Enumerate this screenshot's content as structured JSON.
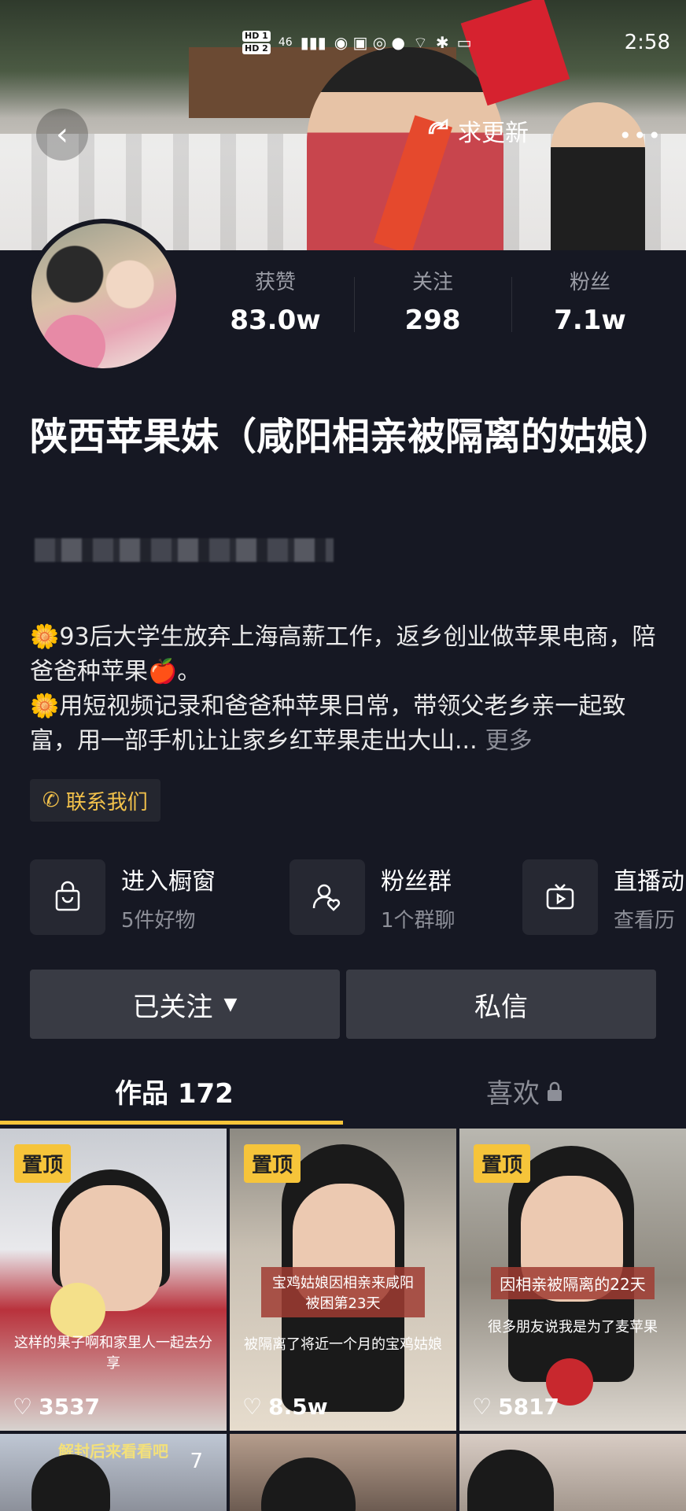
{
  "status_bar": {
    "hd1": "HD 1",
    "hd2": "HD 2",
    "network": "46",
    "time": "2:58"
  },
  "header": {
    "back_icon": "chevron-left-icon",
    "update_label": "求更新",
    "more_icon": "more-dots-icon"
  },
  "profile": {
    "stats": [
      {
        "label": "获赞",
        "value": "83.0w"
      },
      {
        "label": "关注",
        "value": "298"
      },
      {
        "label": "粉丝",
        "value": "7.1w"
      }
    ],
    "name": "陕西苹果妹（咸阳相亲被隔离的姑娘）",
    "bio_line1": "🌼93后大学生放弃上海高薪工作，返乡创业做苹果电商，陪爸爸种苹果🍎。",
    "bio_line2": "🌼用短视频记录和爸爸种苹果日常，带领父老乡亲一起致富，用一部手机让让家乡红苹果走出大山...",
    "bio_more": "更多",
    "contact_label": "联系我们"
  },
  "features": [
    {
      "title": "进入橱窗",
      "sub": "5件好物",
      "icon": "shopping-bag-icon"
    },
    {
      "title": "粉丝群",
      "sub": "1个群聊",
      "icon": "fan-group-icon"
    },
    {
      "title": "直播动",
      "sub": "查看历",
      "icon": "live-tv-icon"
    }
  ],
  "actions": {
    "follow_label": "已关注",
    "message_label": "私信"
  },
  "tabs": {
    "works": "作品 172",
    "likes": "喜欢"
  },
  "videos": [
    {
      "pin": "置顶",
      "likes": "3537",
      "caption": "这样的果子啊和家里人一起去分享"
    },
    {
      "pin": "置顶",
      "likes": "8.5w",
      "caption_title": "宝鸡姑娘因相亲来咸阳被困第23天",
      "caption": "被隔离了将近一个月的宝鸡姑娘"
    },
    {
      "pin": "置顶",
      "likes": "5817",
      "caption_title": "因相亲被隔离的22天",
      "caption": "很多朋友说我是为了麦苹果"
    }
  ],
  "row2": {
    "tile1_caption": "解封后来看看吧",
    "tile1_count": "7"
  },
  "colors": {
    "background": "#161823",
    "accent": "#f6c43a",
    "button": "#393b44"
  }
}
